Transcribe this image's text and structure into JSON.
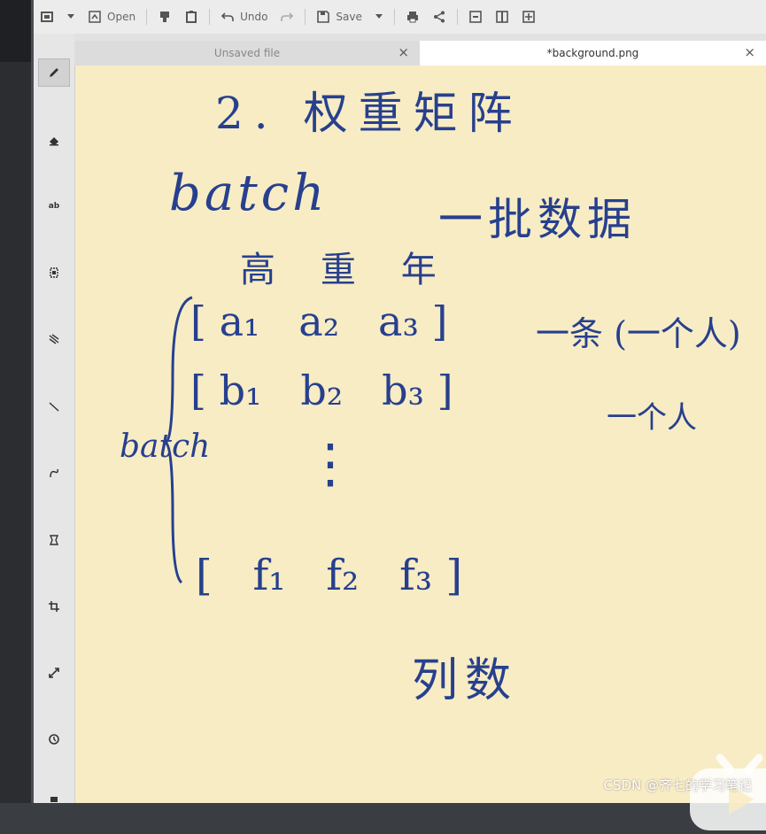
{
  "toolbar": {
    "open_label": "Open",
    "undo_label": "Undo",
    "save_label": "Save"
  },
  "tabs": [
    {
      "label": "Unsaved file",
      "close": "×"
    },
    {
      "label": "*background.png",
      "close": "×"
    }
  ],
  "sidebar": {
    "tools": [
      "pencil-icon",
      "eraser-icon",
      "text-tool-icon",
      "highlighter-icon",
      "blur-icon",
      "line-icon",
      "curve-icon",
      "select-icon",
      "crop-icon",
      "resize-icon",
      "rotate-icon",
      "more-icon"
    ],
    "text_tool_label": "ab"
  },
  "notes": {
    "title": "2. 权重矩阵",
    "batch_word": "batch",
    "batch_meaning": "一批数据",
    "headers": "高    重    年",
    "row_a": "[ a₁   a₂   a₃ ]",
    "row_a_note": "一条 (一个人)",
    "row_b": "[ b₁   b₂   b₃ ]",
    "row_b_note": "一个人",
    "ellipsis": "⋮",
    "brace_label": "batch",
    "row_f": "[   f₁   f₂   f₃ ]",
    "columns_label": "列数"
  },
  "watermark": "CSDN @齐七的学习笔记",
  "colors": {
    "ink": "#27408e",
    "paper": "#f8ecc4",
    "toolbar_bg": "#ececec"
  }
}
